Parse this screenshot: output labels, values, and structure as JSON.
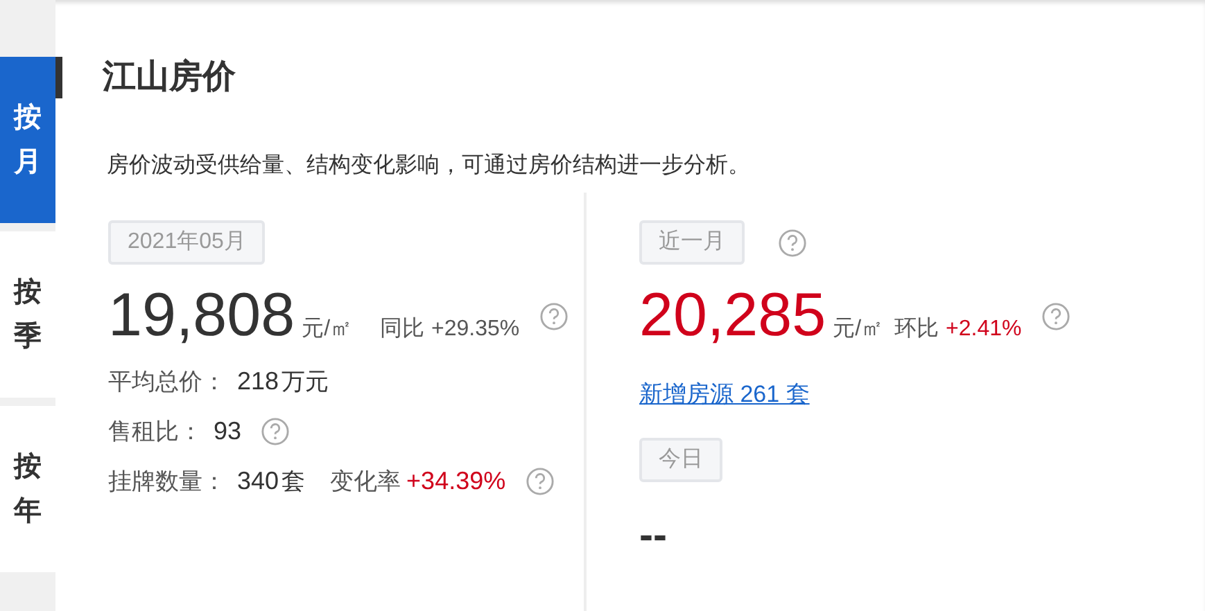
{
  "tabs": [
    {
      "label": "按月",
      "selected": true
    },
    {
      "label": "按季",
      "selected": false
    },
    {
      "label": "按年",
      "selected": false
    }
  ],
  "title": "江山房价",
  "description": "房价波动受供给量、结构变化影响，可通过房价结构进一步分析。",
  "left": {
    "period": "2021年05月",
    "price": "19,808",
    "price_highlight": false,
    "unit": "元/㎡",
    "change_label": "同比",
    "change_value": "+29.35%",
    "change_highlight": false,
    "stats": [
      {
        "label": "平均总价：",
        "value": "218",
        "unit": "万元",
        "help": false
      },
      {
        "label": "售租比：",
        "value": "93",
        "help": true
      },
      {
        "label": "挂牌数量：",
        "value": "340",
        "unit": "套",
        "extra_label": "变化率",
        "extra_value": "+34.39%",
        "extra_highlight": true,
        "help": true
      }
    ]
  },
  "right": {
    "period": "近一月",
    "price": "20,285",
    "price_highlight": true,
    "unit": "元/㎡",
    "change_label": "环比",
    "change_value": "+2.41%",
    "change_highlight": true,
    "link": "新增房源 261 套",
    "today_label": "今日",
    "today_value": "--"
  }
}
